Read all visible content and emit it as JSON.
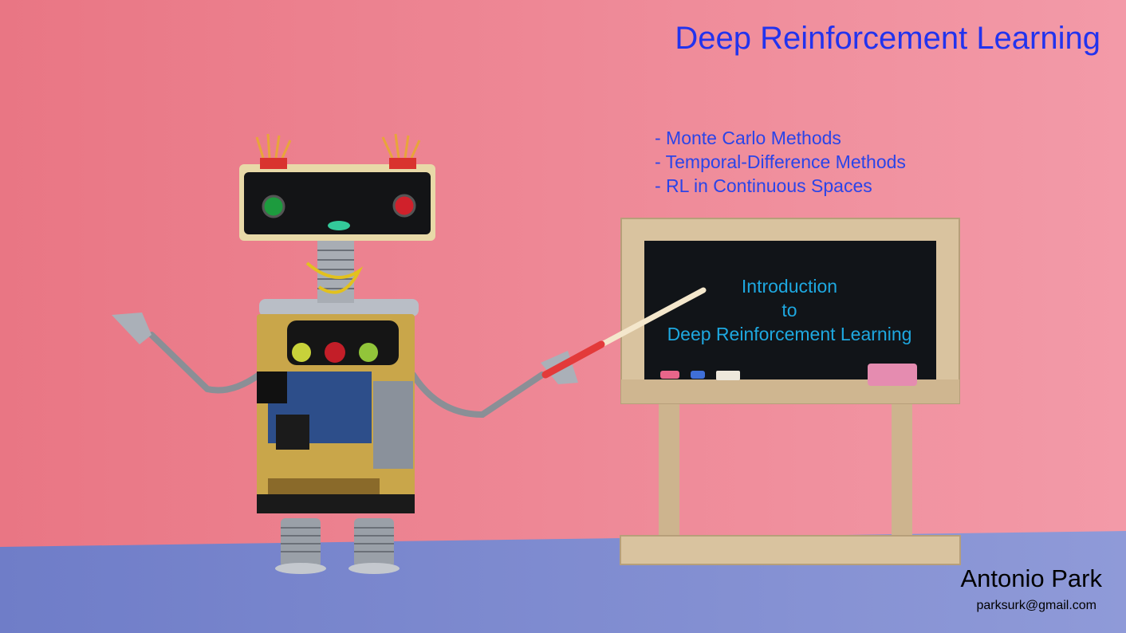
{
  "slide": {
    "title": "Deep Reinforcement Learning",
    "topics": [
      "- Monte Carlo Methods",
      "- Temporal-Difference Methods",
      "- RL in Continuous Spaces"
    ],
    "board": {
      "line1": "Introduction",
      "line2": "to",
      "line3": "Deep Reinforcement Learning"
    },
    "author": "Antonio Park",
    "email": "parksurk@gmail.com"
  },
  "colors": {
    "wall": "#ee8896",
    "floor": "#7a87cc",
    "title": "#2233ee",
    "topics": "#2a44e8",
    "board_text": "#1ea8e0",
    "chalkboard": "#111418",
    "wood": "#d9c39f"
  }
}
